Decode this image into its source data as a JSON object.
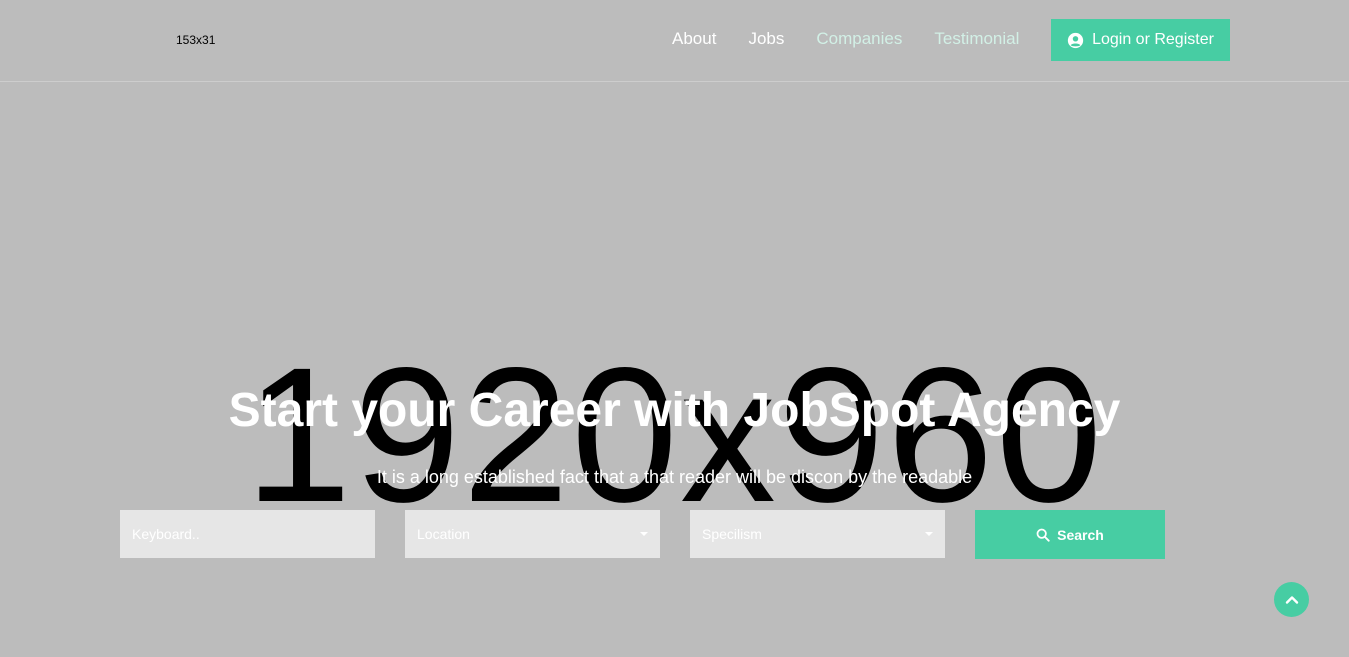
{
  "header": {
    "logo_placeholder": "153x31",
    "nav": [
      {
        "label": "About"
      },
      {
        "label": "Jobs"
      },
      {
        "label": "Companies"
      },
      {
        "label": "Testimonial"
      }
    ],
    "login_label": "Login or Register",
    "login_icon": "user-circle-icon"
  },
  "hero": {
    "placeholder_image_text": "1920x960",
    "title": "Start your Career with JobSpot Agency",
    "subtitle": "It is a long established fact that a that reader will be discon by the readable"
  },
  "search": {
    "keyword_placeholder": "Keyboard..",
    "location_selected": "Location",
    "specialism_selected": "Specilism",
    "button_label": "Search",
    "button_icon": "search-icon"
  },
  "back_to_top_icon": "chevron-up-icon",
  "colors": {
    "accent": "#47cda3",
    "background": "#bcbcbc",
    "field_bg": "#e6e6e6"
  }
}
